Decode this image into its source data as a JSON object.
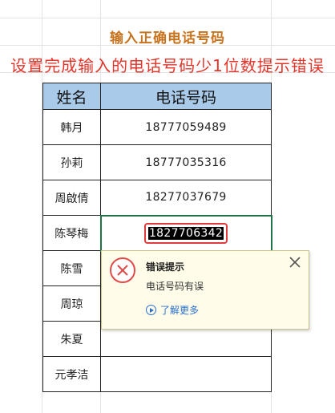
{
  "headings": {
    "title": "输入正确电话号码",
    "subtitle": "设置完成输入的电话号码少1位数提示错误"
  },
  "table": {
    "headers": [
      "姓名",
      "电话号码"
    ],
    "rows": [
      {
        "name": "韩月",
        "phone": "18777059489"
      },
      {
        "name": "孙莉",
        "phone": "18777035316"
      },
      {
        "name": "周啟倩",
        "phone": "18277037679"
      },
      {
        "name": "陈琴梅",
        "phone": "1827706342"
      },
      {
        "name": "陈雪",
        "phone": ""
      },
      {
        "name": "周琼",
        "phone": ""
      },
      {
        "name": "朱夏",
        "phone": ""
      },
      {
        "name": "元孝洁",
        "phone": ""
      }
    ]
  },
  "error_popup": {
    "title": "错误提示",
    "message": "电话号码有误",
    "link": "了解更多",
    "icon": "error-x-icon",
    "close_icon": "close-icon"
  },
  "colors": {
    "title": "#c8741f",
    "subtitle": "#e3342a",
    "header_fill": "#a9cbe9",
    "active_cell_border": "#217346",
    "error": "#e24a4a",
    "link": "#2a6fd0",
    "popup_fill": "#fffde9"
  }
}
